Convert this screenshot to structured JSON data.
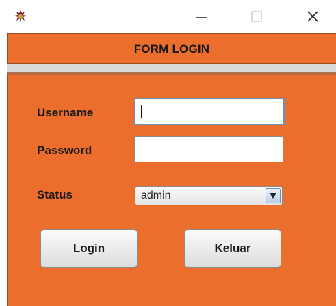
{
  "window": {
    "controls": {
      "minimize_icon": "minimize-icon",
      "maximize_icon": "maximize-icon",
      "close_icon": "close-icon"
    }
  },
  "header": {
    "title": "FORM LOGIN"
  },
  "form": {
    "username_label": "Username",
    "username_value": "",
    "password_label": "Password",
    "password_value": "",
    "status_label": "Status",
    "status_selected": "admin"
  },
  "buttons": {
    "login_label": "Login",
    "keluar_label": "Keluar"
  },
  "colors": {
    "panel": "#ec6e2d",
    "separator": "#d9d9d9"
  }
}
